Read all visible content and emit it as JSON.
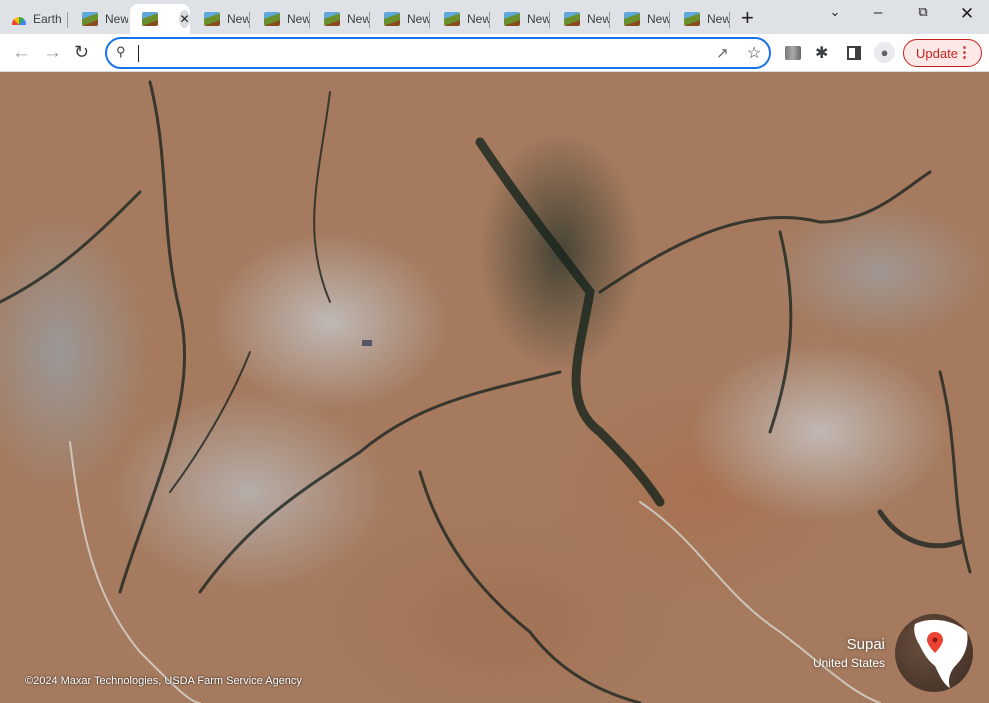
{
  "tabs": [
    {
      "label": "Earth",
      "icon": "google-earth-rainbow-icon"
    },
    {
      "label": "New",
      "icon": "landscape-favicon"
    },
    {
      "label": "",
      "icon": "landscape-favicon",
      "active": true
    },
    {
      "label": "New",
      "icon": "landscape-favicon"
    },
    {
      "label": "New",
      "icon": "landscape-favicon"
    },
    {
      "label": "New",
      "icon": "landscape-favicon"
    },
    {
      "label": "New",
      "icon": "landscape-favicon"
    },
    {
      "label": "New",
      "icon": "landscape-favicon"
    },
    {
      "label": "New",
      "icon": "landscape-favicon"
    },
    {
      "label": "New",
      "icon": "landscape-favicon"
    },
    {
      "label": "New",
      "icon": "landscape-favicon"
    },
    {
      "label": "New",
      "icon": "landscape-favicon"
    }
  ],
  "toolbar": {
    "address_value": "",
    "update_label": "Update"
  },
  "map": {
    "credit": "©2024 Maxar Technologies, USDA Farm Service Agency",
    "place_name": "Supai",
    "place_country": "United States"
  },
  "colors": {
    "accent": "#1a73e8",
    "update": "#c5221f"
  }
}
